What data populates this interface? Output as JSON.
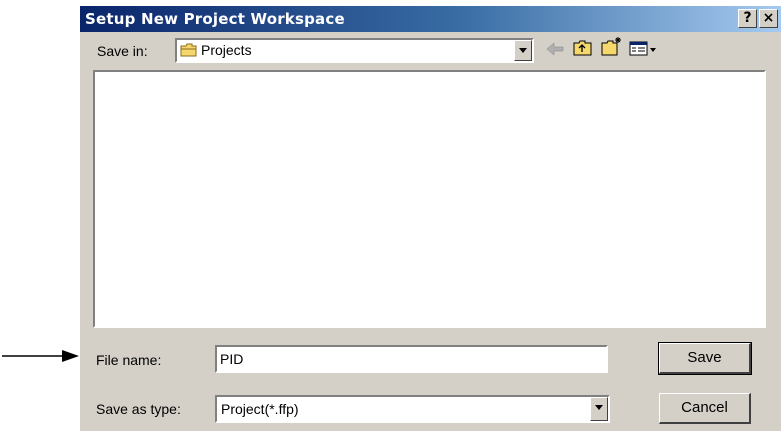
{
  "window": {
    "title": "Setup New Project Workspace",
    "help_glyph": "?",
    "close_glyph": "×"
  },
  "save_in": {
    "label": "Save in:",
    "value": "Projects"
  },
  "toolbar": {
    "icons": [
      "back-arrow-icon",
      "up-one-level-icon",
      "new-folder-icon",
      "view-menu-icon"
    ]
  },
  "file_list": {
    "items": []
  },
  "file_name": {
    "label": "File name:",
    "value": "PID"
  },
  "save_as_type": {
    "label": "Save as type:",
    "value": "Project(*.ffp)"
  },
  "buttons": {
    "save": "Save",
    "cancel": "Cancel"
  },
  "colors": {
    "title_bar_start": "#0a246a",
    "title_bar_end": "#a6caf0",
    "dialog_face": "#d4d0c8",
    "folder_icon": "#f5d76e"
  }
}
